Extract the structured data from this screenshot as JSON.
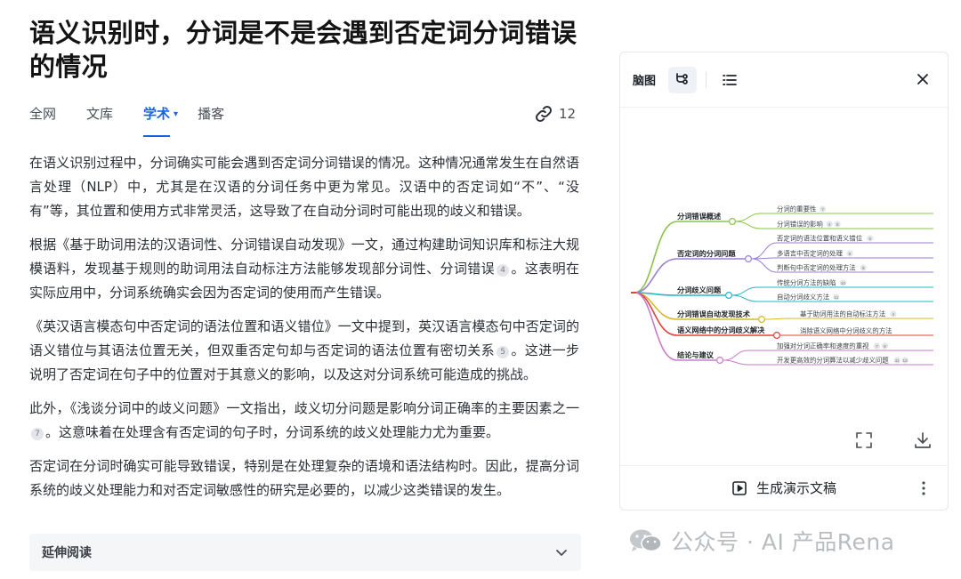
{
  "title": "语义识别时，分词是不是会遇到否定词分词错误的情况",
  "tabs": [
    {
      "label": "全网"
    },
    {
      "label": "文库"
    },
    {
      "label": "学术"
    },
    {
      "label": "播客"
    }
  ],
  "active_tab_caret": "▾",
  "ref_count": "12",
  "paragraphs": [
    {
      "text": "在语义识别过程中，分词确实可能会遇到否定词分词错误的情况。这种情况通常发生在自然语言处理（NLP）中，尤其是在汉语的分词任务中更为常见。汉语中的否定词如“不”、“没有”等，其位置和使用方式非常灵活，这导致了在自动分词时可能出现的歧义和错误。"
    },
    {
      "pre": "根据《基于助词用法的汉语词性、分词错误自动发现》一文，通过构建助词知识库和标注大规模语料，发现基于规则的助词用法自动标注方法能够发现部分词性、分词错误",
      "cite": "4",
      "post": "。这表明在实际应用中，分词系统确实会因为否定词的使用而产生错误。"
    },
    {
      "pre": "《英汉语言模态句中否定词的语法位置和语义错位》一文中提到，英汉语言模态句中否定词的语义错位与其语法位置无关，但双重否定句却与否定词的语法位置有密切关系",
      "cite": "5",
      "post": "。这进一步说明了否定词在句子中的位置对于其意义的影响，以及这对分词系统可能造成的挑战。"
    },
    {
      "pre": "此外，《浅谈分词中的歧义问题》一文指出，歧义切分问题是影响分词正确率的主要因素之一",
      "cite": "7",
      "post": "。这意味着在处理含有否定词的句子时，分词系统的歧义处理能力尤为重要。"
    },
    {
      "text": "否定词在分词时确实可能导致错误，特别是在处理复杂的语境和语法结构时。因此，提高分词系统的歧义处理能力和对否定词敏感性的研究是必要的，以减少这类错误的发生。"
    }
  ],
  "further_reading": {
    "label": "延伸阅读"
  },
  "panel": {
    "title": "脑图",
    "generate_label": "生成演示文稿"
  },
  "mindmap": {
    "branches": [
      {
        "label": "分词错误概述",
        "color": "#8bc34a",
        "leaves": [
          {
            "text": "分词的重要性",
            "cites": [
              "7"
            ]
          },
          {
            "text": "分词错误的影响",
            "cites": [
              "4",
              "8"
            ]
          }
        ]
      },
      {
        "label": "否定词的分词问题",
        "color": "#9c7fd6",
        "leaves": [
          {
            "text": "否定词的语法位置和语义错位",
            "cites": [
              "5"
            ]
          },
          {
            "text": "多语言中否定词的处理",
            "cites": [
              "6"
            ]
          },
          {
            "text": "判断句中否定词的处理方法",
            "cites": [
              "9"
            ]
          }
        ]
      },
      {
        "label": "分词歧义问题",
        "color": "#26b5c8",
        "leaves": [
          {
            "text": "传统分词方法的缺陷",
            "cites": [
              "10"
            ]
          },
          {
            "text": "自动分词歧义方法",
            "cites": [
              "11"
            ]
          }
        ]
      },
      {
        "label": "分词错误自动发现技术",
        "color": "#d7b82a",
        "leaves": [
          {
            "text": "基于助词用法的自动标注方法",
            "cites": [
              "4"
            ]
          }
        ]
      },
      {
        "label": "语义网络中的分词歧义解决",
        "color": "#e0433c",
        "leaves": [
          {
            "text": "消除语义网络中分词歧义的方法",
            "cites": []
          }
        ]
      },
      {
        "label": "结论与建议",
        "color": "#c77bc9",
        "leaves": [
          {
            "text": "加强对分词正确率和速度的重视",
            "cites": [
              "7",
              "8"
            ]
          },
          {
            "text": "开发更高效的分词算法以减少歧义问题",
            "cites": [
              "11",
              "12"
            ]
          }
        ]
      }
    ]
  },
  "watermark": "公众号 · AI 产品Rena"
}
